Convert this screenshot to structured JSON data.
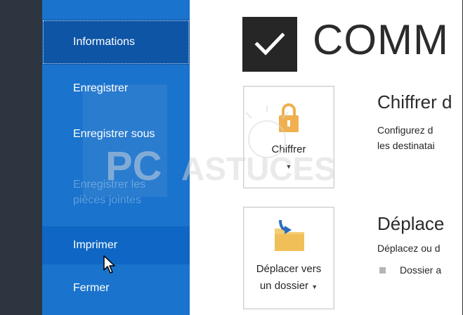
{
  "sidebar": {
    "items": [
      {
        "label": "Informations"
      },
      {
        "label": "Enregistrer"
      },
      {
        "label": "Enregistrer sous"
      },
      {
        "label_line1": "Enregistrer les",
        "label_line2": "pièces jointes"
      },
      {
        "label": "Imprimer"
      },
      {
        "label": "Fermer"
      }
    ]
  },
  "main": {
    "title": "COMM",
    "sections": [
      {
        "card_label": "Chiffrer",
        "title": "Chiffrer d",
        "desc_line1": "Configurez d",
        "desc_line2": "les destinatai"
      },
      {
        "card_label_line1": "Déplacer vers",
        "card_label_line2": "un dossier",
        "title": "Déplace",
        "desc_line1": "Déplacez ou d",
        "bullet_text": "Dossier a"
      }
    ]
  },
  "watermark": {
    "text_left": "PC",
    "text_right": "ASTUCES"
  },
  "colors": {
    "sidebar_bg": "#1a73cc",
    "sidebar_selected": "#0e55a6",
    "sidebar_hover": "#0f66c4",
    "dark_strip": "#2d3640",
    "lock_color": "#f0b050",
    "folder_color": "#f5cd73",
    "arrow_color": "#2a6bbf"
  }
}
